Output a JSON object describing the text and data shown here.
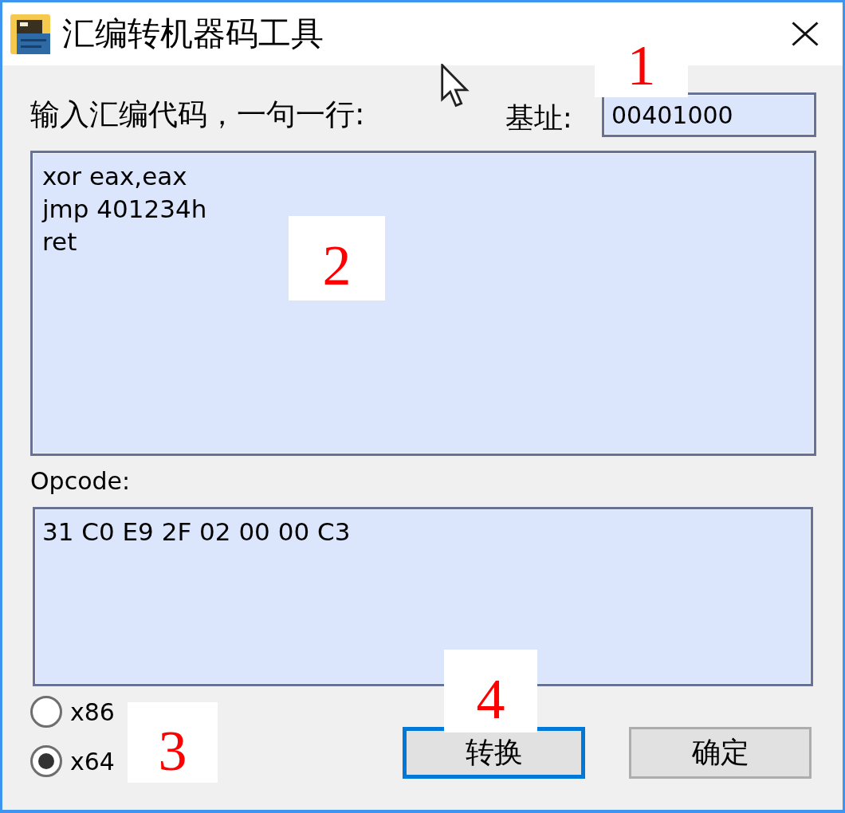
{
  "window": {
    "title": "汇编转机器码工具"
  },
  "assembly": {
    "label": "输入汇编代码，一句一行:",
    "lines": [
      "xor eax,eax",
      "jmp 401234h",
      "ret"
    ]
  },
  "base_address": {
    "label": "基址:",
    "value": "00401000"
  },
  "opcode": {
    "label": "Opcode:",
    "value": "31 C0 E9 2F 02 00 00 C3"
  },
  "architecture": [
    {
      "label": "x86",
      "selected": false
    },
    {
      "label": "x64",
      "selected": true
    }
  ],
  "buttons": [
    {
      "label": "转换",
      "focused": true
    },
    {
      "label": "确定",
      "focused": false
    }
  ],
  "annotations": [
    {
      "label": "1"
    },
    {
      "label": "2"
    },
    {
      "label": "3"
    },
    {
      "label": "4"
    }
  ]
}
